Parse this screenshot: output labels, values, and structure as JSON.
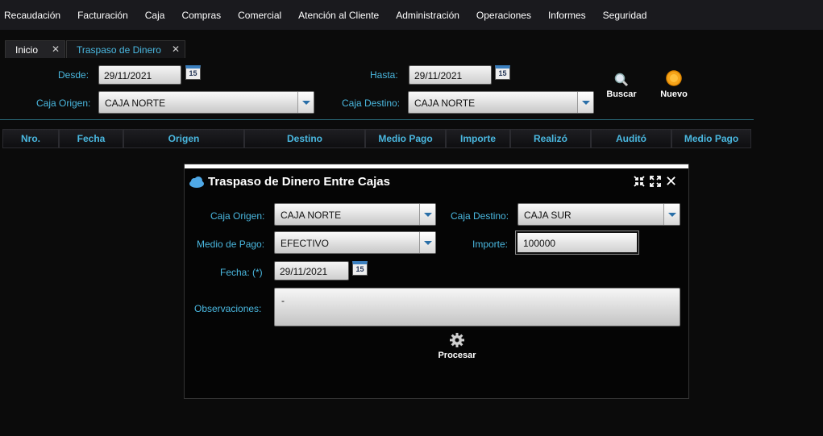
{
  "menu": [
    "Recaudación",
    "Facturación",
    "Caja",
    "Compras",
    "Comercial",
    "Atención al Cliente",
    "Administración",
    "Operaciones",
    "Informes",
    "Seguridad"
  ],
  "tabs": [
    {
      "label": "Inicio",
      "close": "✕"
    },
    {
      "label": "Traspaso de Dinero",
      "close": "✕"
    }
  ],
  "filters": {
    "desde_label": "Desde:",
    "desde_value": "29/11/2021",
    "hasta_label": "Hasta:",
    "hasta_value": "29/11/2021",
    "calendar_text": "15",
    "caja_origen_label": "Caja Origen:",
    "caja_origen_value": "CAJA NORTE",
    "caja_destino_label": "Caja Destino:",
    "caja_destino_value": "CAJA NORTE",
    "buscar_label": "Buscar",
    "nuevo_label": "Nuevo"
  },
  "grid": {
    "columns": [
      "Nro.",
      "Fecha",
      "Origen",
      "Destino",
      "Medio Pago",
      "Importe",
      "Realizó",
      "Auditó",
      "Medio Pago"
    ]
  },
  "dialog": {
    "title": "Traspaso de Dinero Entre Cajas",
    "caja_origen_label": "Caja Origen:",
    "caja_origen_value": "CAJA NORTE",
    "caja_destino_label": "Caja Destino:",
    "caja_destino_value": "CAJA SUR",
    "medio_pago_label": "Medio de Pago:",
    "medio_pago_value": "EFECTIVO",
    "importe_label": "Importe:",
    "importe_value": "100000",
    "fecha_label": "Fecha: (*)",
    "fecha_value": "29/11/2021",
    "observaciones_label": "Observaciones:",
    "observaciones_value": "-",
    "procesar_label": "Procesar",
    "close_glyph": "✕"
  },
  "colors": {
    "accent": "#4ab8e0",
    "background": "#0b0b0b",
    "menubar": "#1a1a1e"
  }
}
